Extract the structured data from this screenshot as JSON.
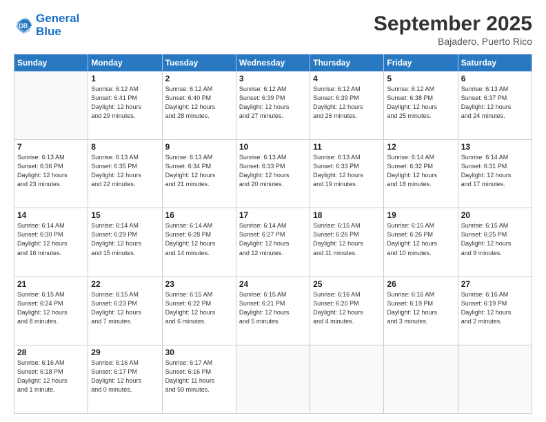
{
  "header": {
    "logo_line1": "General",
    "logo_line2": "Blue",
    "month": "September 2025",
    "location": "Bajadero, Puerto Rico"
  },
  "weekdays": [
    "Sunday",
    "Monday",
    "Tuesday",
    "Wednesday",
    "Thursday",
    "Friday",
    "Saturday"
  ],
  "weeks": [
    [
      {
        "day": "",
        "info": ""
      },
      {
        "day": "1",
        "info": "Sunrise: 6:12 AM\nSunset: 6:41 PM\nDaylight: 12 hours\nand 29 minutes."
      },
      {
        "day": "2",
        "info": "Sunrise: 6:12 AM\nSunset: 6:40 PM\nDaylight: 12 hours\nand 28 minutes."
      },
      {
        "day": "3",
        "info": "Sunrise: 6:12 AM\nSunset: 6:39 PM\nDaylight: 12 hours\nand 27 minutes."
      },
      {
        "day": "4",
        "info": "Sunrise: 6:12 AM\nSunset: 6:39 PM\nDaylight: 12 hours\nand 26 minutes."
      },
      {
        "day": "5",
        "info": "Sunrise: 6:12 AM\nSunset: 6:38 PM\nDaylight: 12 hours\nand 25 minutes."
      },
      {
        "day": "6",
        "info": "Sunrise: 6:13 AM\nSunset: 6:37 PM\nDaylight: 12 hours\nand 24 minutes."
      }
    ],
    [
      {
        "day": "7",
        "info": "Sunrise: 6:13 AM\nSunset: 6:36 PM\nDaylight: 12 hours\nand 23 minutes."
      },
      {
        "day": "8",
        "info": "Sunrise: 6:13 AM\nSunset: 6:35 PM\nDaylight: 12 hours\nand 22 minutes."
      },
      {
        "day": "9",
        "info": "Sunrise: 6:13 AM\nSunset: 6:34 PM\nDaylight: 12 hours\nand 21 minutes."
      },
      {
        "day": "10",
        "info": "Sunrise: 6:13 AM\nSunset: 6:33 PM\nDaylight: 12 hours\nand 20 minutes."
      },
      {
        "day": "11",
        "info": "Sunrise: 6:13 AM\nSunset: 6:33 PM\nDaylight: 12 hours\nand 19 minutes."
      },
      {
        "day": "12",
        "info": "Sunrise: 6:14 AM\nSunset: 6:32 PM\nDaylight: 12 hours\nand 18 minutes."
      },
      {
        "day": "13",
        "info": "Sunrise: 6:14 AM\nSunset: 6:31 PM\nDaylight: 12 hours\nand 17 minutes."
      }
    ],
    [
      {
        "day": "14",
        "info": "Sunrise: 6:14 AM\nSunset: 6:30 PM\nDaylight: 12 hours\nand 16 minutes."
      },
      {
        "day": "15",
        "info": "Sunrise: 6:14 AM\nSunset: 6:29 PM\nDaylight: 12 hours\nand 15 minutes."
      },
      {
        "day": "16",
        "info": "Sunrise: 6:14 AM\nSunset: 6:28 PM\nDaylight: 12 hours\nand 14 minutes."
      },
      {
        "day": "17",
        "info": "Sunrise: 6:14 AM\nSunset: 6:27 PM\nDaylight: 12 hours\nand 12 minutes."
      },
      {
        "day": "18",
        "info": "Sunrise: 6:15 AM\nSunset: 6:26 PM\nDaylight: 12 hours\nand 11 minutes."
      },
      {
        "day": "19",
        "info": "Sunrise: 6:15 AM\nSunset: 6:26 PM\nDaylight: 12 hours\nand 10 minutes."
      },
      {
        "day": "20",
        "info": "Sunrise: 6:15 AM\nSunset: 6:25 PM\nDaylight: 12 hours\nand 9 minutes."
      }
    ],
    [
      {
        "day": "21",
        "info": "Sunrise: 6:15 AM\nSunset: 6:24 PM\nDaylight: 12 hours\nand 8 minutes."
      },
      {
        "day": "22",
        "info": "Sunrise: 6:15 AM\nSunset: 6:23 PM\nDaylight: 12 hours\nand 7 minutes."
      },
      {
        "day": "23",
        "info": "Sunrise: 6:15 AM\nSunset: 6:22 PM\nDaylight: 12 hours\nand 6 minutes."
      },
      {
        "day": "24",
        "info": "Sunrise: 6:15 AM\nSunset: 6:21 PM\nDaylight: 12 hours\nand 5 minutes."
      },
      {
        "day": "25",
        "info": "Sunrise: 6:16 AM\nSunset: 6:20 PM\nDaylight: 12 hours\nand 4 minutes."
      },
      {
        "day": "26",
        "info": "Sunrise: 6:16 AM\nSunset: 6:19 PM\nDaylight: 12 hours\nand 3 minutes."
      },
      {
        "day": "27",
        "info": "Sunrise: 6:16 AM\nSunset: 6:19 PM\nDaylight: 12 hours\nand 2 minutes."
      }
    ],
    [
      {
        "day": "28",
        "info": "Sunrise: 6:16 AM\nSunset: 6:18 PM\nDaylight: 12 hours\nand 1 minute."
      },
      {
        "day": "29",
        "info": "Sunrise: 6:16 AM\nSunset: 6:17 PM\nDaylight: 12 hours\nand 0 minutes."
      },
      {
        "day": "30",
        "info": "Sunrise: 6:17 AM\nSunset: 6:16 PM\nDaylight: 11 hours\nand 59 minutes."
      },
      {
        "day": "",
        "info": ""
      },
      {
        "day": "",
        "info": ""
      },
      {
        "day": "",
        "info": ""
      },
      {
        "day": "",
        "info": ""
      }
    ]
  ]
}
